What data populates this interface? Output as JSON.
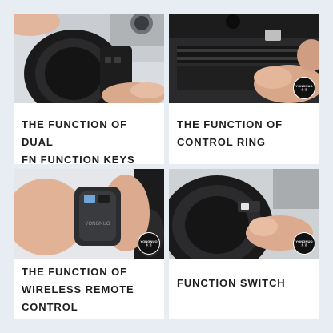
{
  "panels": [
    {
      "caption_line1": "THE FUNCTION OF DUAL",
      "caption_line2": "FN FUNCTION KEYS"
    },
    {
      "caption_line1": "THE FUNCTION OF",
      "caption_line2": "CONTROL RING"
    },
    {
      "caption_line1": "THE FUNCTION OF",
      "caption_line2": "WIRELESS REMOTE",
      "caption_line3": "CONTROL"
    },
    {
      "caption_line1": "FUNCTION SWITCH"
    }
  ],
  "brand": {
    "logo_text": "YONGNUO",
    "logo_sub": "永 诺",
    "device_text": "YONGNUO"
  }
}
